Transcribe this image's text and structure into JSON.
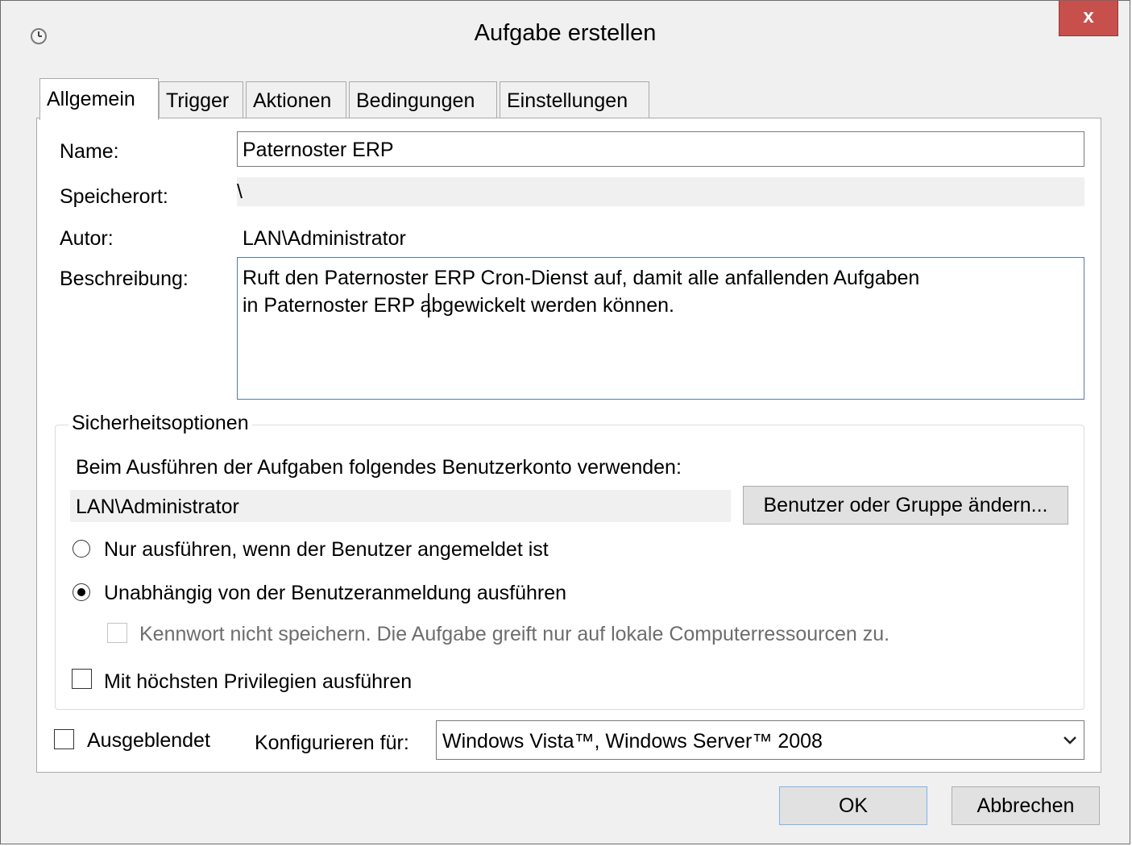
{
  "window": {
    "title": "Aufgabe erstellen",
    "close_symbol": "x",
    "icon": "clock-icon"
  },
  "tabs": [
    "Allgemein",
    "Trigger",
    "Aktionen",
    "Bedingungen",
    "Einstellungen"
  ],
  "active_tab": "Allgemein",
  "general": {
    "name_label": "Name:",
    "name_value": "Paternoster ERP",
    "location_label": "Speicherort:",
    "location_value": "\\",
    "author_label": "Autor:",
    "author_value": "LAN\\Administrator",
    "description_label": "Beschreibung:",
    "description_line1": "Ruft den Paternoster ERP Cron-Dienst auf, damit alle anfallenden Aufgaben",
    "description_line2": "in Paternoster ERP abgewickelt werden können."
  },
  "security": {
    "title": "Sicherheitsoptionen",
    "account_prompt": "Beim Ausführen der Aufgaben folgendes Benutzerkonto verwenden:",
    "account_value": "LAN\\Administrator",
    "change_button": "Benutzer oder Gruppe ändern...",
    "radio_logged_on": {
      "label": "Nur ausführen, wenn der Benutzer angemeldet ist",
      "selected": false
    },
    "radio_independent": {
      "label": "Unabhängig von der Benutzeranmeldung ausführen",
      "selected": true
    },
    "no_password": {
      "label": "Kennwort nicht speichern. Die Aufgabe greift nur auf lokale Computerressourcen zu.",
      "checked": false,
      "enabled": false
    },
    "highest_privileges": {
      "label": "Mit höchsten Privilegien ausführen",
      "checked": false
    }
  },
  "footer": {
    "hidden": {
      "label": "Ausgeblendet",
      "checked": false
    },
    "configure_label": "Konfigurieren für:",
    "configure_value": "Windows Vista™, Windows Server™ 2008"
  },
  "buttons": {
    "ok": "OK",
    "cancel": "Abbrechen"
  },
  "colors": {
    "close_button": "#c7504d",
    "window_bg": "#f0f0f0",
    "panel_bg": "#ffffff"
  }
}
